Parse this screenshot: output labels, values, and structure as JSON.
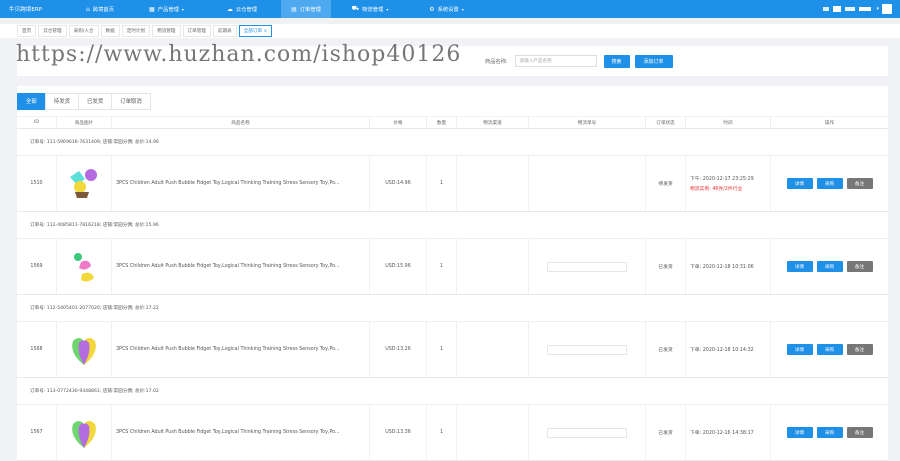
{
  "app": {
    "brand": "牛贝跨境ERP"
  },
  "nav": [
    {
      "label": "跨境首页",
      "icon": "home-icon",
      "caret": false,
      "active": false
    },
    {
      "label": "产品管理",
      "icon": "grid-icon",
      "caret": true,
      "active": false
    },
    {
      "label": "云仓管理",
      "icon": "cloud-icon",
      "caret": false,
      "active": false
    },
    {
      "label": "订单管理",
      "icon": "order-icon",
      "caret": false,
      "active": true
    },
    {
      "label": "物流管理",
      "icon": "truck-icon",
      "caret": true,
      "active": false
    },
    {
      "label": "系统设置",
      "icon": "gear-icon",
      "caret": true,
      "active": false
    }
  ],
  "topright": {
    "caret": "▾"
  },
  "tags": [
    "首页",
    "云仓管理",
    "采购/入仓",
    "数据",
    "定时计划",
    "物流管理",
    "订单管理",
    "前期表",
    "全部订单 ×"
  ],
  "search": {
    "label": "商品名称:",
    "placeholder": "请输入产品名称",
    "search_btn": "搜索",
    "add_btn": "添加订单"
  },
  "watermark": "https://www.huzhan.com/ishop40126",
  "status_tabs": [
    "全部",
    "待发货",
    "已发货",
    "订单取消"
  ],
  "columns": [
    "ID",
    "商品图片",
    "商品名称",
    "价格",
    "数量",
    "物流渠道",
    "物流单号",
    "订单状态",
    "时间",
    "操作"
  ],
  "orders": [
    {
      "header": "订单号: 111-5969616-7631409; 店铺:常园分佣; 总价:14.96",
      "id": "1510",
      "name": "3PCS Children Adult Push Bubble Fidget Toy,Logical Thinking Training Stress Sensory Toy,Po...",
      "price": "USD:14.96",
      "qty": "1",
      "status": "待发货",
      "time": "下午: 2020-12-17 23:25:29",
      "note": "物流实例: 46件/2件行业",
      "buttons": [
        "详情",
        "采购",
        "备注"
      ]
    },
    {
      "header": "订单号: 112-4085811-7816218; 店铺:常园分佣; 总价:15.96",
      "id": "1569",
      "name": "3PCS Children Adult Push Bubble Fidget Toy,Logical Thinking Training Stress Sensory Toy,Po...",
      "price": "USD:15.96",
      "qty": "1",
      "status": "已发货",
      "time": "下单: 2020-12-18 10:31:06",
      "note": "",
      "buttons": [
        "详情",
        "采购",
        "备注"
      ]
    },
    {
      "header": "订单号: 112-5405401-2077020; 店铺:常园分佣; 总价:17.22",
      "id": "1568",
      "name": "3PCS Children Adult Push Bubble Fidget Toy,Logical Thinking Training Stress Sensory Toy,Po...",
      "price": "USD:13.26",
      "qty": "1",
      "status": "已发货",
      "time": "下单: 2020-12-18 10:14:32",
      "note": "",
      "buttons": [
        "详情",
        "采购",
        "备注"
      ]
    },
    {
      "header": "订单号: 113-0772430-9348861; 店铺:常园分佣; 总价:17.02",
      "id": "1567",
      "name": "3PCS Children Adult Push Bubble Fidget Toy,Logical Thinking Training Stress Sensory Toy,Po...",
      "price": "USD:13.36",
      "qty": "1",
      "status": "已发货",
      "time": "下单: 2020-12-16 14:38:17",
      "note": "",
      "buttons": [
        "详情",
        "采购",
        "备注"
      ]
    }
  ],
  "colors": {
    "primary": "#1f90e8",
    "nav_active": "#4ea9f0",
    "gray_btn": "#777777",
    "alert": "#ee3333"
  }
}
